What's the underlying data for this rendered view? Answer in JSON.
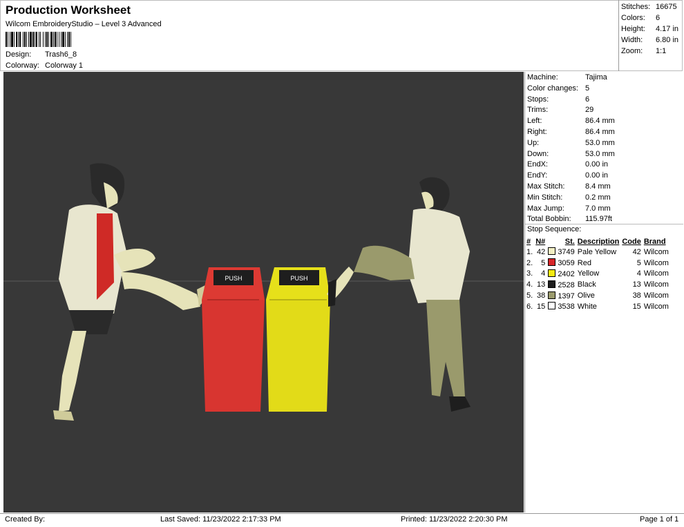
{
  "header": {
    "title": "Production Worksheet",
    "subtitle": "Wilcom EmbroideryStudio – Level 3 Advanced",
    "design_label": "Design:",
    "design_value": "Trash6_8",
    "colorway_label": "Colorway:",
    "colorway_value": "Colorway 1"
  },
  "summary": [
    {
      "label": "Stitches:",
      "value": "16675"
    },
    {
      "label": "Colors:",
      "value": "6"
    },
    {
      "label": "Height:",
      "value": "4.17 in"
    },
    {
      "label": "Width:",
      "value": "6.80 in"
    },
    {
      "label": "Zoom:",
      "value": "1:1"
    }
  ],
  "stats": [
    {
      "label": "Machine:",
      "value": "Tajima"
    },
    {
      "label": "Color changes:",
      "value": "5"
    },
    {
      "label": "Stops:",
      "value": "6"
    },
    {
      "label": "Trims:",
      "value": "29"
    },
    {
      "label": "Left:",
      "value": "86.4 mm"
    },
    {
      "label": "Right:",
      "value": "86.4 mm"
    },
    {
      "label": "Up:",
      "value": "53.0 mm"
    },
    {
      "label": "Down:",
      "value": "53.0 mm"
    },
    {
      "label": "EndX:",
      "value": "0.00 in"
    },
    {
      "label": "EndY:",
      "value": "0.00 in"
    },
    {
      "label": "Max Stitch:",
      "value": "8.4 mm"
    },
    {
      "label": "Min Stitch:",
      "value": "0.2 mm"
    },
    {
      "label": "Max Jump:",
      "value": "7.0 mm"
    },
    {
      "label": "Total Bobbin:",
      "value": "115.97ft"
    }
  ],
  "stop_sequence": {
    "title": "Stop Sequence:",
    "headers": [
      "#",
      "N#",
      "St.",
      "Description",
      "Code",
      "Brand"
    ],
    "rows": [
      {
        "num": "1.",
        "n": "42",
        "st": "3749",
        "color": "#f3f0c4",
        "desc": "Pale Yellow",
        "code": "42",
        "brand": "Wilcom"
      },
      {
        "num": "2.",
        "n": "5",
        "st": "3059",
        "color": "#d8262a",
        "desc": "Red",
        "code": "5",
        "brand": "Wilcom"
      },
      {
        "num": "3.",
        "n": "4",
        "st": "2402",
        "color": "#f4ea12",
        "desc": "Yellow",
        "code": "4",
        "brand": "Wilcom"
      },
      {
        "num": "4.",
        "n": "13",
        "st": "2528",
        "color": "#1e1e1e",
        "desc": "Black",
        "code": "13",
        "brand": "Wilcom"
      },
      {
        "num": "5.",
        "n": "38",
        "st": "1397",
        "color": "#9a9a6c",
        "desc": "Olive",
        "code": "38",
        "brand": "Wilcom"
      },
      {
        "num": "6.",
        "n": "15",
        "st": "3538",
        "color": "#ffffff",
        "desc": "White",
        "code": "15",
        "brand": "Wilcom"
      }
    ]
  },
  "canvas": {
    "bin_label": "PUSH",
    "background": "#383838"
  },
  "footer": {
    "created_by": "Created By:",
    "last_saved": "Last Saved: 11/23/2022 2:17:33 PM",
    "printed": "Printed: 11/23/2022 2:20:30 PM",
    "page": "Page 1 of 1"
  }
}
